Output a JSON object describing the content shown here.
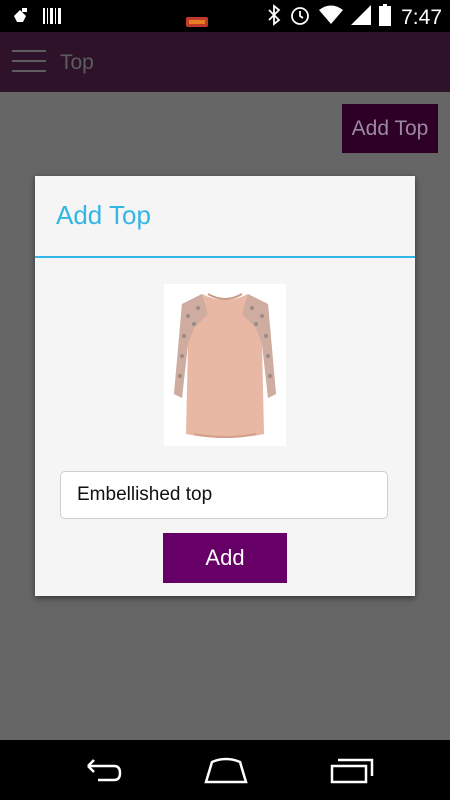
{
  "status_bar": {
    "time": "7:47",
    "icons": [
      "cleaner-icon",
      "barcode-icon",
      "battery-low-icon",
      "bluetooth-icon",
      "alarm-icon",
      "wifi-icon",
      "signal-icon",
      "battery-icon"
    ]
  },
  "app_bar": {
    "title": "Top",
    "menu_icon": "hamburger-menu-icon",
    "background": "#2e1229"
  },
  "content": {
    "add_top_button_label": "Add Top"
  },
  "dialog": {
    "title": "Add Top",
    "accent_color": "#33b5e5",
    "image_icon": "blouse-image",
    "name_value": "Embellished top",
    "add_button_label": "Add",
    "add_button_color": "#660066"
  },
  "nav_bar": {
    "buttons": [
      "back-icon",
      "home-icon",
      "recent-apps-icon"
    ]
  }
}
